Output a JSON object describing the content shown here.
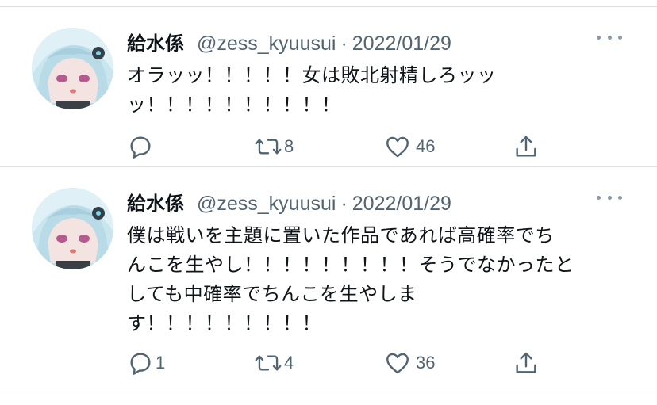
{
  "tweets": [
    {
      "name": "給水係",
      "handle": "@zess_kyuusui",
      "separator": "·",
      "date": "2022/01/29",
      "lines": [
        "オラッッ！！！！！女は敗北射精しろッッ",
        "ッ！！！！！！！！！！"
      ],
      "replies": "",
      "retweets": "8",
      "likes": "46"
    },
    {
      "name": "給水係",
      "handle": "@zess_kyuusui",
      "separator": "·",
      "date": "2022/01/29",
      "lines": [
        "僕は戦いを主題に置いた作品であれば高確率でち",
        "んこを生やし！！！！！！！！！そうでなかったと",
        "しても中確率でちんこを生やしま",
        "す！！！！！！！！！"
      ],
      "replies": "1",
      "retweets": "4",
      "likes": "36"
    }
  ],
  "colors": {
    "text": "#0f1419",
    "secondary": "#536471",
    "divider": "#dcdfe2",
    "icon": "#536471"
  },
  "icons": [
    "reply-icon",
    "retweet-icon",
    "like-icon",
    "share-icon",
    "more-icon"
  ]
}
